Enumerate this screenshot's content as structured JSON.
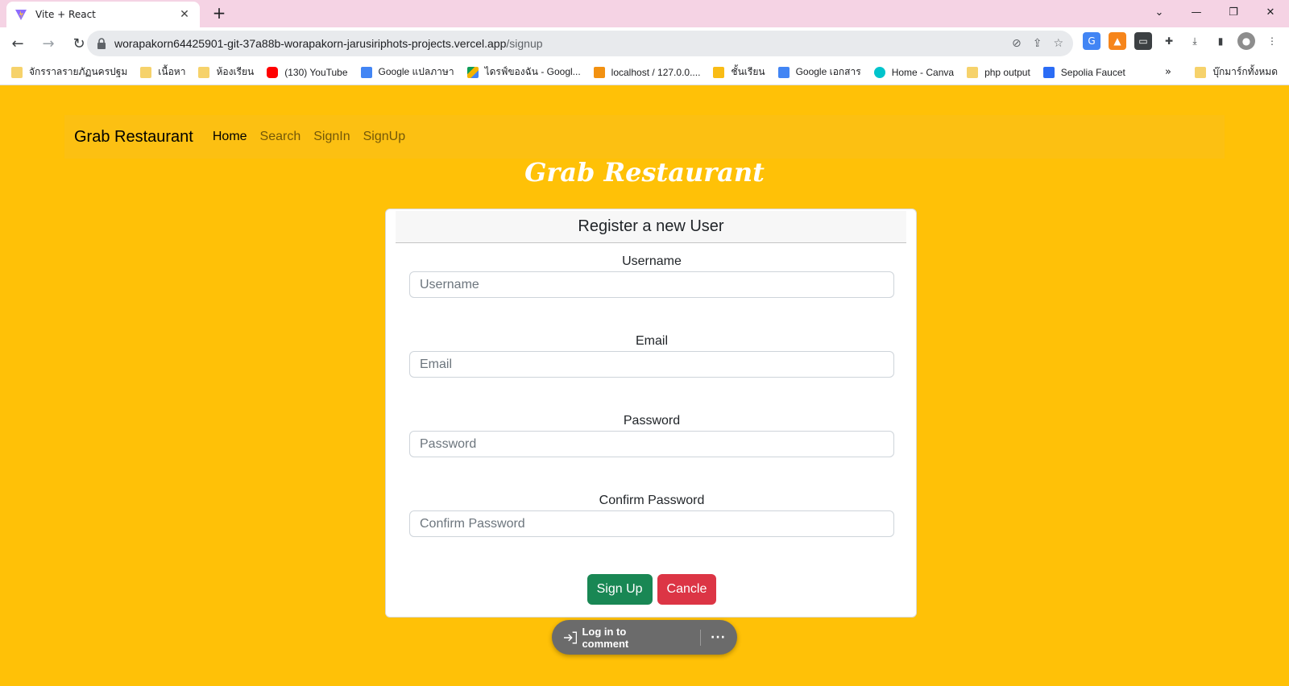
{
  "browser": {
    "tab_title": "Vite + React",
    "url_host": "worapakorn64425901-git-37a88b-worapakorn-jarusiriphots-projects.vercel.app",
    "url_path": "/signup",
    "bookmarks": [
      {
        "label": "จักรราลรายภัฏนครปฐม",
        "icon": "folder-icon"
      },
      {
        "label": "เนื้อหา",
        "icon": "folder-icon"
      },
      {
        "label": "ห้องเรียน",
        "icon": "folder-icon"
      },
      {
        "label": "(130) YouTube",
        "icon": "youtube-icon"
      },
      {
        "label": "Google แปลภาษา",
        "icon": "translate-icon"
      },
      {
        "label": "ไดรฟ์ของฉัน - Googl...",
        "icon": "drive-icon"
      },
      {
        "label": "localhost / 127.0.0....",
        "icon": "phpmyadmin-icon"
      },
      {
        "label": "ชั้นเรียน",
        "icon": "classroom-icon"
      },
      {
        "label": "Google เอกสาร",
        "icon": "docs-icon"
      },
      {
        "label": "Home - Canva",
        "icon": "canva-icon"
      },
      {
        "label": "php output",
        "icon": "folder-icon"
      },
      {
        "label": "Sepolia Faucet",
        "icon": "sepolia-icon"
      }
    ],
    "bookmarks_more": "»",
    "all_bookmarks": "บุ๊กมาร์กทั้งหมด"
  },
  "navbar": {
    "brand": "Grab Restaurant",
    "links": [
      "Home",
      "Search",
      "SignIn",
      "SignUp"
    ]
  },
  "page": {
    "title": "Grab Restaurant"
  },
  "form": {
    "header": "Register a new User",
    "fields": [
      {
        "label": "Username",
        "placeholder": "Username"
      },
      {
        "label": "Email",
        "placeholder": "Email"
      },
      {
        "label": "Password",
        "placeholder": "Password"
      },
      {
        "label": "Confirm Password",
        "placeholder": "Confirm Password"
      }
    ],
    "submit_label": "Sign Up",
    "cancel_label": "Cancle"
  },
  "comment_bar": {
    "label": "Log in to comment",
    "more": "···"
  },
  "colors": {
    "page_background": "#ffc107",
    "success": "#198754",
    "danger": "#dc3545"
  }
}
